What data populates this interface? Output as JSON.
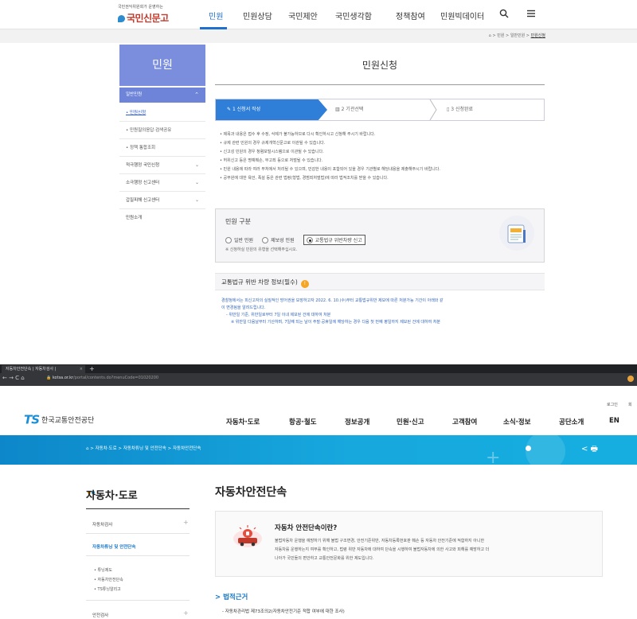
{
  "top": {
    "logo_caption": "국민권익위원회가 운영하는",
    "logo_name": "국민신문고",
    "nav": [
      "민원",
      "민원상담",
      "국민제안",
      "국민생각함",
      "정책참여",
      "민원빅데이터"
    ],
    "breadcrumb": [
      "⌂",
      "민원",
      "일반민원",
      "민원신청"
    ],
    "sidebar": {
      "heading": "민원",
      "active_group": "일반민원",
      "sub_items": [
        "• 민원신청",
        "• 민원질의응답·검색공유",
        "• 정책 통합조회"
      ],
      "items": [
        "적극행정 국민신청",
        "소극행정 신고센터",
        "갑질피해 신고센터",
        "민원소개"
      ]
    },
    "page_title": "민원신청",
    "steps": [
      "1 신청서 작성",
      "2 기관선택",
      "3 신청완료"
    ],
    "notes": [
      "• 제목과 내용은 접수 후 수정, 삭제가 불가능하므로 다시 확인하시고 신청해 주시기 바랍니다.",
      "• 규제 관련 민원의 경우 규제개혁신문고로 이관될 수 있습니다.",
      "• 신고성 민원의 경우 청렴포털시스템으로 이관될 수 있습니다.",
      "• 허위신고 등은 명예훼손, 무고죄 등으로 처벌될 수 있습니다.",
      "• 민원 내용에 따라 여러 부처에서 처리될 수 있으며, 민감한 내용이 포함되어 있을 경우 기관별로 해당내용을 제출해주시기 바랍니다.",
      "• 공무원에 대한 욕언, 폭설 등은 관련 법령(형법, 경범죄처벌법)에 따라 법적조치를 받을 수 있습니다."
    ],
    "category": {
      "title": "민원 구분",
      "options": [
        "일반 민원",
        "제보성 민원",
        "교통법규 위반차량 신고"
      ],
      "hint": "※ 신청하실 민원의 유형을 선택해주십시오."
    },
    "traffic": {
      "title": "교통법규 위반 차량 정보(필수)",
      "badge": "!",
      "lines": [
        "경찰청에서는 피신고자의 실질적인 방어권을 보장하고자 2022. 6. 10.(수)부터 교통법규위반 제보에 따른 처분가능 기간이 아래와 같",
        "이 변경됨을 알려드립니다.",
        "- 위반일 기준, 위반일로부터 7일 이내 제보된 건에 대하여 처분",
        "※ 위반일 다음날부터 기산하며, 7일째 되는 날이 주말·공휴일에 해당하는 경우 다음 첫 번째 평일까지 제보된 건에 대하여 처분"
      ]
    }
  },
  "bottom": {
    "browser": {
      "tab_title": "자동차안전단속 | 자동차검사 |",
      "new_tab": "+",
      "nav_buttons": "← → C ⌂",
      "url_host": "kotsa.or.kr",
      "url_path": "/portal/contents.do?menuCode=01020200"
    },
    "util_links": [
      "로그인",
      "회"
    ],
    "logo_mark": "TS",
    "logo_name": "한국교통안전공단",
    "gnb": [
      "자동차·도로",
      "항공·철도",
      "정보공개",
      "민원·신고",
      "고객참여",
      "소식·정보",
      "공단소개",
      "EN"
    ],
    "breadcrumb": "⌂  >  자동차·도로  >  자동차튜닝 및 안전단속  >  자동차안전단속",
    "banner_icons": "<  🖶",
    "sidebar": {
      "title": "자동차·도로",
      "items": [
        "자동차검사",
        "자동차튜닝 및 안전단속",
        "안전검사"
      ],
      "sub_items": [
        "• 튜닝제도",
        "• 자동차안전단속",
        "• TS튜닝알리고"
      ]
    },
    "page_title": "자동차안전단속",
    "card": {
      "title": "자동차 안전단속이란?",
      "lines": [
        "불법자동차 운행을 예방하기 위해 불법 구조변경, 안전기준위반, 자동차등록번호판 훼손 등 자동차 안전기준에 적합하지 아니한",
        "자동차를 운행하는지 여부를 확인하고, 법령 위반 자동차에 대하여 단속을 시행하여 불법자동차에 의한 사고와 피해를 예방하고 더",
        "나아가 국민들의 편안하고 교통안전문화를 위한 제도입니다."
      ]
    },
    "law": {
      "title": "> 법적근거",
      "item": "- 자동차관리법 제73조의2(자동차안전기준 적합 여부에 대한 조사)"
    }
  },
  "colors": {
    "epeople_accent": "#2f7fd8",
    "epeople_side": "#7a8edd",
    "kotsa_blue": "#1776c5",
    "banner": "#17a8de"
  }
}
